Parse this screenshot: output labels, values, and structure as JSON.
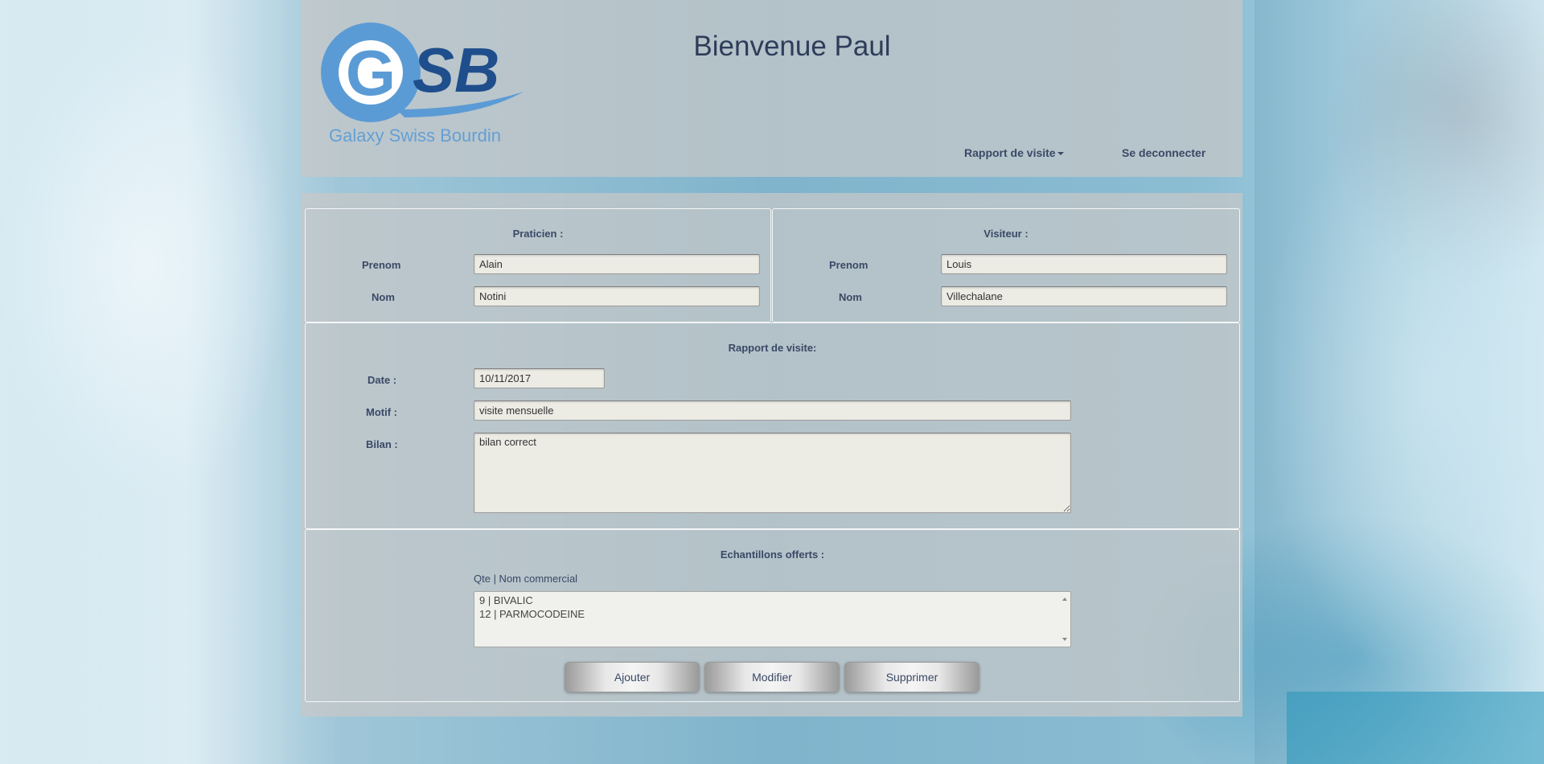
{
  "header": {
    "logo_text": "GSB",
    "logo_subtitle": "Galaxy Swiss Bourdin",
    "welcome": "Bienvenue Paul",
    "nav": {
      "rapport_label": "Rapport de visite",
      "logout_label": "Se deconnecter"
    }
  },
  "praticien": {
    "title": "Praticien :",
    "prenom_label": "Prenom",
    "prenom_value": "Alain",
    "nom_label": "Nom",
    "nom_value": "Notini"
  },
  "visiteur": {
    "title": "Visiteur :",
    "prenom_label": "Prenom",
    "prenom_value": "Louis",
    "nom_label": "Nom",
    "nom_value": "Villechalane"
  },
  "rapport": {
    "title": "Rapport de visite:",
    "date_label": "Date :",
    "date_value": "10/11/2017",
    "motif_label": "Motif :",
    "motif_value": "visite mensuelle",
    "bilan_label": "Bilan :",
    "bilan_value": "bilan correct"
  },
  "echantillons": {
    "title": "Echantillons offerts :",
    "list_header": "Qte | Nom commercial",
    "items": [
      "9 | BIVALIC",
      "12 | PARMOCODEINE"
    ],
    "buttons": {
      "add": "Ajouter",
      "edit": "Modifier",
      "delete": "Supprimer"
    }
  },
  "colors": {
    "text": "#3a4866",
    "logo_light_blue": "#5b9bd5",
    "logo_dark_blue": "#1f4e8c"
  }
}
